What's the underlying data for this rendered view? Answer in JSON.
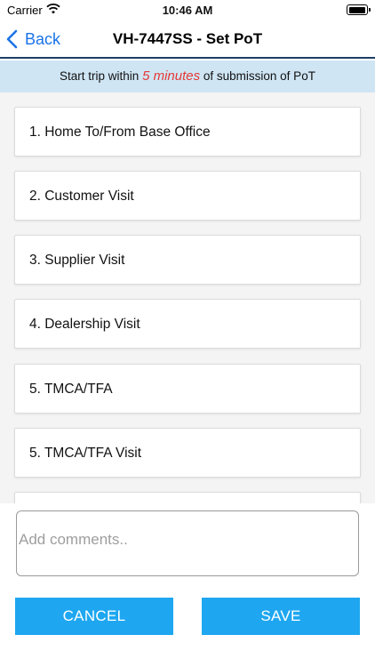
{
  "status_bar": {
    "carrier": "Carrier",
    "time": "10:46 AM"
  },
  "nav": {
    "back_label": "Back",
    "title": "VH-7447SS - Set PoT"
  },
  "notice": {
    "prefix": "Start trip within",
    "highlight": "5 minutes",
    "suffix": "of submission of PoT",
    "highlight_color": "#e53935"
  },
  "purpose_list": [
    {
      "label": "1. Home To/From Base Office"
    },
    {
      "label": "2. Customer Visit"
    },
    {
      "label": "3. Supplier Visit"
    },
    {
      "label": "4. Dealership Visit"
    },
    {
      "label": "5. TMCA/TFA"
    },
    {
      "label": "5. TMCA/TFA Visit"
    },
    {
      "label": ""
    }
  ],
  "comments": {
    "placeholder": "Add comments..",
    "value": ""
  },
  "buttons": {
    "cancel": "CANCEL",
    "save": "SAVE"
  },
  "colors": {
    "accent": "#1ea7f0",
    "link": "#1a73e8",
    "notice_bg": "#cfe5f4",
    "nav_border": "#1c3f66"
  },
  "icons": {
    "back": "chevron-left-icon",
    "wifi": "wifi-icon",
    "battery": "battery-icon"
  }
}
